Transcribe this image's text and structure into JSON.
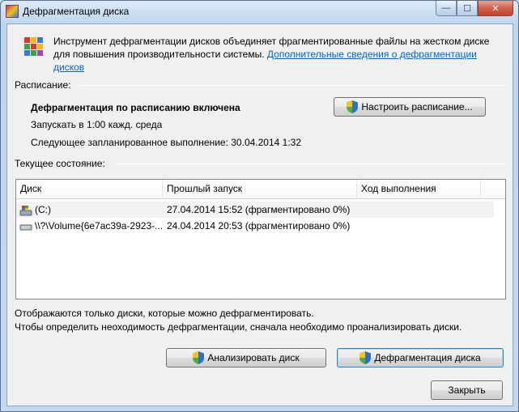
{
  "window": {
    "title": "Дефрагментация диска",
    "minimize_glyph": "—",
    "maximize_glyph": "☐",
    "close_glyph": "✕"
  },
  "intro": {
    "text": "Инструмент дефрагментации дисков объединяет фрагментированные файлы на жестком диске для повышения производительности системы. ",
    "link": "Дополнительные сведения о дефрагментации дисков"
  },
  "schedule": {
    "group_label": "Расписание:",
    "status": "Дефрагментация по расписанию включена",
    "run_at": "Запускать в 1:00 кажд. среда",
    "next_run": "Следующее запланированное выполнение: 30.04.2014 1:32",
    "configure_button": "Настроить расписание..."
  },
  "current": {
    "group_label": "Текущее состояние:",
    "columns": [
      "Диск",
      "Прошлый запуск",
      "Ход выполнения"
    ],
    "rows": [
      {
        "disk": "(C:)",
        "last_run": "27.04.2014 15:52 (фрагментировано 0%)",
        "progress": "",
        "icon": "system-drive-icon"
      },
      {
        "disk": "\\\\?\\Volume{6e7ac39a-2923-...",
        "last_run": "24.04.2014 20:53 (фрагментировано 0%)",
        "progress": "",
        "icon": "drive-icon"
      }
    ]
  },
  "notes": {
    "line1": "Отображаются только диски, которые можно дефрагментировать.",
    "line2": "Чтобы определить неоходимость  дефрагментации, сначала необходимо проанализировать диски."
  },
  "buttons": {
    "analyze": "Анализировать диск",
    "defrag": "Дефрагментация диска",
    "close": "Закрыть"
  },
  "colors": {
    "link": "#0066cc",
    "selection": "#f2f2f2"
  }
}
